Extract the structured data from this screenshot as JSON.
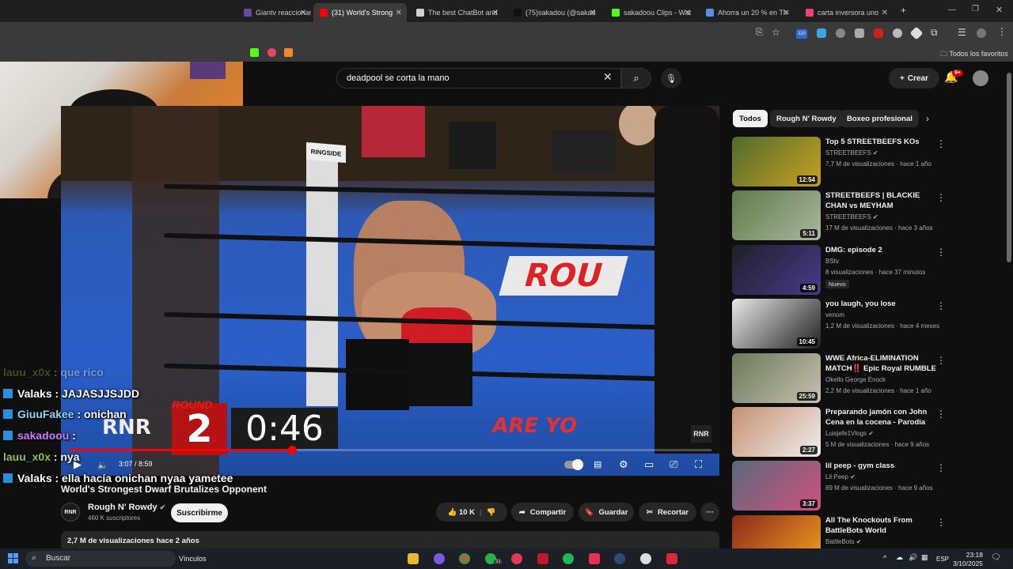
{
  "browser": {
    "tabs": [
      {
        "title": "Giantv reaccionan",
        "color": "#6a4a9a",
        "active": false
      },
      {
        "title": "(31) World's Strong",
        "color": "#ff0000",
        "active": true
      },
      {
        "title": "The best ChatBot and",
        "color": "#cfcfcf",
        "active": false
      },
      {
        "title": "(75)sakadou (@sakad",
        "color": "#111111",
        "active": false
      },
      {
        "title": "sakadoou Clips - Wat",
        "color": "#53fc18",
        "active": false
      },
      {
        "title": "Ahorra un 20 % en Th",
        "color": "#5a8de8",
        "active": false
      },
      {
        "title": "carta inversora uno",
        "color": "#e8456a",
        "active": false
      }
    ],
    "new_tab": "+",
    "bookmarks_all": "Todos los favoritos",
    "extension_badge": "110"
  },
  "youtube": {
    "search_value": "deadpool se corta la mano",
    "create_label": "Crear",
    "notif_badge": "9+"
  },
  "video": {
    "ringside": "RINGSIDE",
    "round_label": "ROUND",
    "round": "2",
    "clock": "0:46",
    "logo": "RNR",
    "watermark": "RNR",
    "mat_text": "ROU",
    "mat_text2": "ARE YO",
    "timecode": "3:07 / 8:59",
    "progress": 0.347,
    "title": "World's Strongest Dwarf Brutalizes Opponent"
  },
  "chat": [
    {
      "name": "lauu_x0x",
      "msg": " : que rico",
      "name_color": "#8bc34a",
      "badge": false,
      "faded": true
    },
    {
      "name": "Valaks",
      "msg": " : JAJASJJSJDD",
      "name_color": "#ffffff",
      "badge": true,
      "faded": false
    },
    {
      "name": "GiuuFakee",
      "msg": " : onichan",
      "name_color": "#8fd6ff",
      "badge": true,
      "faded": false
    },
    {
      "name": "sakadoou",
      "msg": " : ",
      "name_color": "#d27bff",
      "badge": true,
      "faded": false
    },
    {
      "name": "lauu_x0x",
      "msg": " : nya",
      "name_color": "#8bc34a",
      "badge": false,
      "faded": false
    },
    {
      "name": "Valaks",
      "msg": " : ella hacía onichan nyaa yametee",
      "name_color": "#ffffff",
      "badge": true,
      "faded": false
    }
  ],
  "channel": {
    "logo": "RNR",
    "name": "Rough N' Rowdy",
    "subs": "460 K suscriptores",
    "subscribe": "Suscribirme"
  },
  "actions": {
    "likes": "10 K",
    "share": "Compartir",
    "save": "Guardar",
    "clip": "Recortar",
    "more": "···"
  },
  "description": {
    "summary": "2,7 M de visualizaciones  hace 2 años"
  },
  "sidebar": {
    "chips": [
      "Todos",
      "Rough N' Rowdy",
      "Boxeo profesional"
    ],
    "videos": [
      {
        "title": "Top 5 STREETBEEFS KOs",
        "channel": "STREETBEEFS",
        "verified": true,
        "meta": "7,7 M de visualizaciones · hace 1 año",
        "duration": "12:54",
        "thumb": "#4f6b2e",
        "thumb2": "#c9a020",
        "new": ""
      },
      {
        "title": "STREETBEEFS | BLACKIE CHAN vs MEYHAM",
        "channel": "STREETBEEFS",
        "verified": true,
        "meta": "17 M de visualizaciones · hace 3 años",
        "duration": "5:11",
        "thumb": "#5f7a4a",
        "thumb2": "#a9b7a0",
        "new": ""
      },
      {
        "title": "DMG: episode 2",
        "channel": "BStv",
        "verified": false,
        "meta": "8 visualizaciones · hace 37 minutos",
        "duration": "4:59",
        "thumb": "#1f1f2a",
        "thumb2": "#4a3a8a",
        "new": "Nuevo"
      },
      {
        "title": "you laugh, you lose",
        "channel": "venom",
        "verified": false,
        "meta": "1,2 M de visualizaciones · hace 4 meses",
        "duration": "10:45",
        "thumb": "#e8e8e8",
        "thumb2": "#222222",
        "new": ""
      },
      {
        "title": "WWE  Africa-ELIMINATION MATCH‼️ Epic Royal RUMBLE ...",
        "channel": "Okello George Enock",
        "verified": false,
        "meta": "2,2 M de visualizaciones · hace 1 año",
        "duration": "25:59",
        "thumb": "#6a7a5a",
        "thumb2": "#c8c0b0",
        "new": ""
      },
      {
        "title": "Preparando jamón con John Cena en la cocena - Parodia",
        "channel": "Luisjefe1Vlogs",
        "verified": true,
        "meta": "5 M de visualizaciones · hace 9 años",
        "duration": "2:27",
        "thumb": "#c89070",
        "thumb2": "#eeeeee",
        "new": ""
      },
      {
        "title": "lil peep - gym class",
        "channel": "Lil Peep",
        "verified": true,
        "meta": "89 M de visualizaciones · hace 9 años",
        "duration": "3:37",
        "thumb": "#5a6a7a",
        "thumb2": "#d05080",
        "new": ""
      },
      {
        "title": "All The Knockouts From BattleBots World Championship...",
        "channel": "BattleBots",
        "verified": true,
        "meta": "",
        "duration": "",
        "thumb": "#8a2a1a",
        "thumb2": "#f0a020",
        "new": ""
      }
    ]
  },
  "taskbar": {
    "search": "Buscar",
    "links": "Vínculos",
    "lang": "ESP",
    "time": "23:18",
    "date": "3/10/2025",
    "whatsapp_badge": "21"
  }
}
